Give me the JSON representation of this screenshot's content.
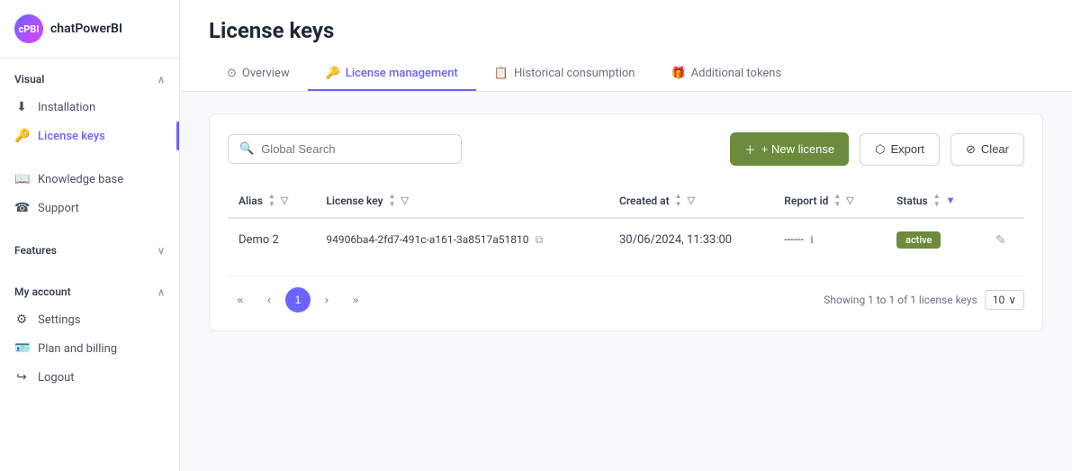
{
  "app": {
    "name": "chatPowerBI",
    "logo_text": "cPBI"
  },
  "sidebar": {
    "sections": [
      {
        "label": "Visual",
        "expanded": true,
        "chevron": "∧",
        "items": [
          {
            "id": "installation",
            "label": "Installation",
            "icon": "⬇",
            "active": false
          },
          {
            "id": "license-keys",
            "label": "License keys",
            "icon": "🔑",
            "active": true
          }
        ]
      },
      {
        "label": "",
        "items": [
          {
            "id": "knowledge-base",
            "label": "Knowledge base",
            "icon": "☎",
            "active": false
          },
          {
            "id": "support",
            "label": "Support",
            "icon": "☎",
            "active": false
          }
        ]
      },
      {
        "label": "Features",
        "expanded": false,
        "chevron": "∨",
        "items": []
      },
      {
        "label": "My account",
        "expanded": true,
        "chevron": "∧",
        "items": [
          {
            "id": "settings",
            "label": "Settings",
            "icon": "⚙",
            "active": false
          },
          {
            "id": "plan-billing",
            "label": "Plan and billing",
            "icon": "🪪",
            "active": false
          },
          {
            "id": "logout",
            "label": "Logout",
            "icon": "↪",
            "active": false
          }
        ]
      }
    ]
  },
  "header": {
    "title": "License keys"
  },
  "tabs": [
    {
      "id": "overview",
      "label": "Overview",
      "icon": "⊙",
      "active": false
    },
    {
      "id": "license-management",
      "label": "License management",
      "icon": "🔑",
      "active": true
    },
    {
      "id": "historical-consumption",
      "label": "Historical consumption",
      "icon": "📋",
      "active": false
    },
    {
      "id": "additional-tokens",
      "label": "Additional tokens",
      "icon": "🎁",
      "active": false
    }
  ],
  "toolbar": {
    "search_placeholder": "Global Search",
    "new_license_label": "+ New license",
    "export_label": "Export",
    "clear_label": "Clear"
  },
  "table": {
    "columns": [
      {
        "id": "alias",
        "label": "Alias",
        "sortable": true,
        "filterable": true
      },
      {
        "id": "license_key",
        "label": "License key",
        "sortable": true,
        "filterable": true
      },
      {
        "id": "created_at",
        "label": "Created at",
        "sortable": true,
        "filterable": true
      },
      {
        "id": "report_id",
        "label": "Report id",
        "sortable": true,
        "filterable": true
      },
      {
        "id": "status",
        "label": "Status",
        "sortable": true,
        "filterable": true
      }
    ],
    "rows": [
      {
        "alias": "Demo 2",
        "license_key": "94906ba4-2fd7-491c-a161-3a8517a51810",
        "created_at": "30/06/2024, 11:33:00",
        "report_id": "------",
        "status": "active"
      }
    ]
  },
  "pagination": {
    "first_label": "«",
    "prev_label": "‹",
    "current_page": 1,
    "next_label": "›",
    "last_label": "»",
    "showing_text": "Showing 1 to 1 of 1 license keys",
    "page_size": "10"
  }
}
